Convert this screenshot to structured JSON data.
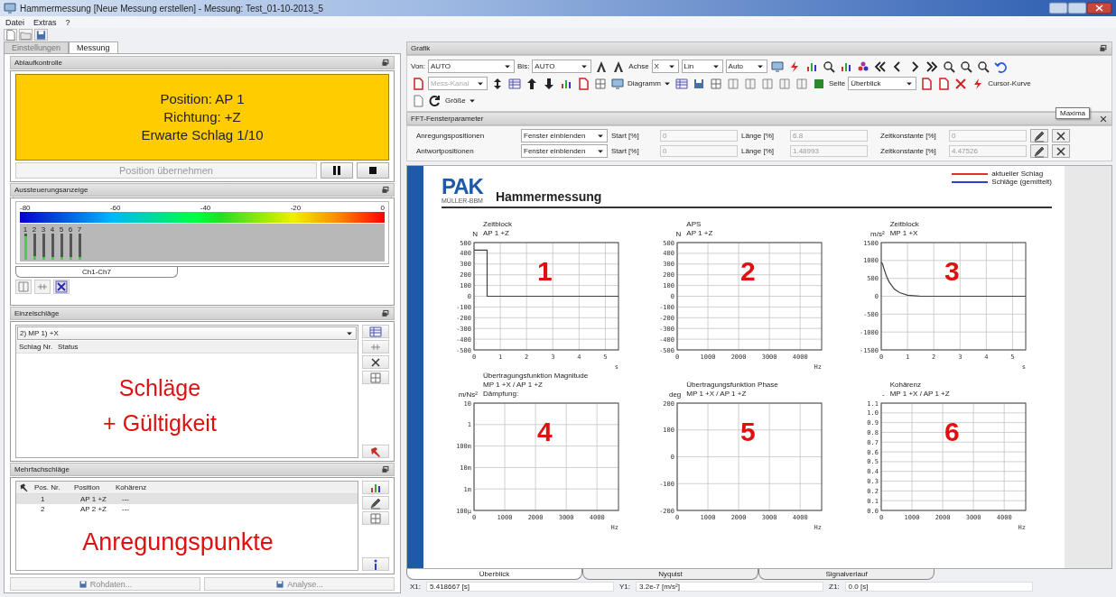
{
  "window": {
    "title": "Hammermessung [Neue Messung erstellen] - Messung: Test_01-10-2013_5"
  },
  "menu": [
    "Datei",
    "Extras",
    "?"
  ],
  "left_tabs": [
    {
      "label": "Einstellungen",
      "selected": false,
      "disabled": true
    },
    {
      "label": "Messung",
      "selected": true,
      "disabled": false
    }
  ],
  "ablauf": {
    "title": "Ablaufkontrolle",
    "lines": [
      "Position: AP 1",
      "Richtung: +Z",
      "Erwarte Schlag 1/10"
    ],
    "button": {
      "label": "Position übernehmen",
      "disabled": true
    }
  },
  "aussteuerung": {
    "title": "Aussteuerungsanzeige",
    "scale": [
      "-80",
      "-60",
      "-40",
      "-20",
      "0"
    ],
    "tab": {
      "label": "Ch1-Ch7",
      "selected": true
    },
    "channels": [
      {
        "label": "1",
        "level": 0.9
      },
      {
        "label": "2",
        "level": 0.15
      },
      {
        "label": "3",
        "level": 0.1
      },
      {
        "label": "4",
        "level": 0.1
      },
      {
        "label": "5",
        "level": 0.1
      },
      {
        "label": "6",
        "level": 0.1
      },
      {
        "label": "7",
        "level": 0.1
      }
    ]
  },
  "einzel": {
    "title": "Einzelschläge",
    "select": "2) MP 1) +X",
    "columns": [
      "Schlag Nr.",
      "Status"
    ],
    "overlay": [
      "Schläge",
      "+ Gültigkeit"
    ]
  },
  "mehrfach": {
    "title": "Mehrfachschläge",
    "columns": [
      "Pos. Nr.",
      "Position",
      "Kohärenz"
    ],
    "rows": [
      {
        "cells": [
          "1",
          "AP 1 +Z",
          "---"
        ],
        "selected": true
      },
      {
        "cells": [
          "2",
          "AP 2 +Z",
          "---"
        ],
        "selected": false
      }
    ],
    "overlay": "Anregungspunkte"
  },
  "bottom_buttons": [
    {
      "label": "Rohdaten...",
      "disabled": true
    },
    {
      "label": "Analyse...",
      "disabled": true
    }
  ],
  "grafik": {
    "title": "Grafik",
    "von_label": "Von:",
    "von": "AUTO",
    "bis_label": "Bis:",
    "bis": "AUTO",
    "achse_label": "Achse",
    "achse": "X",
    "scale": "Lin",
    "range": "Auto",
    "mess_kanal": "Mess-Kanal",
    "diagramm": "Diagramm",
    "seite_label": "Seite",
    "seite": "Überblick",
    "cursor": "Cursor-Kurve",
    "groesse": "Größe",
    "tooltip": "Maxima"
  },
  "fft": {
    "title": "FFT-Fensterparameter",
    "rows": [
      {
        "label": "Anregungspositionen",
        "window": "Fenster einblenden",
        "start_label": "Start [%]",
        "start": "0",
        "len_label": "Länge [%]",
        "len": "6.8",
        "tc_label": "Zeitkonstante [%]",
        "tc": "0"
      },
      {
        "label": "Antwortpositionen",
        "window": "Fenster einblenden",
        "start_label": "Start [%]",
        "start": "0",
        "len_label": "Länge [%]",
        "len": "1.48993",
        "tc_label": "Zeitkonstante [%]",
        "tc": "4.47526"
      }
    ]
  },
  "report": {
    "logo": "PAK",
    "logo_sub": "MÜLLER-BBM",
    "title": "Hammermessung",
    "legend": [
      {
        "label": "aktueller Schlag",
        "color": "#e03030"
      },
      {
        "label": "Schläge (gemittelt)",
        "color": "#3040d0"
      }
    ],
    "charts": [
      {
        "number": "1",
        "title": [
          "Zeitblock",
          "AP 1 +Z"
        ],
        "chart_data": {
          "type": "line",
          "ylabel": "N",
          "xlabel": "s",
          "xlim": [
            0,
            5.5
          ],
          "ylim": [
            -500,
            500
          ],
          "xticks": [
            0,
            1,
            2,
            3,
            4,
            5
          ],
          "yticks": [
            -500,
            -400,
            -300,
            -200,
            -100,
            0,
            100,
            200,
            300,
            400,
            500
          ],
          "x": [
            0,
            0.5,
            0.5,
            5.5
          ],
          "grid": true,
          "series": [
            {
              "color": "#404040",
              "values": [
                430,
                430,
                0,
                0
              ]
            }
          ]
        }
      },
      {
        "number": "2",
        "title": [
          "APS",
          "AP 1 +Z"
        ],
        "chart_data": {
          "type": "line",
          "ylabel": "N",
          "xlabel": "Hz",
          "xlim": [
            0,
            4700
          ],
          "ylim": [
            -500,
            500
          ],
          "xticks": [
            0,
            1000,
            2000,
            3000,
            4000
          ],
          "yticks": [
            -500,
            -400,
            -300,
            -200,
            -100,
            0,
            100,
            200,
            300,
            400,
            500
          ],
          "grid": true
        }
      },
      {
        "number": "3",
        "title": [
          "Zeitblock",
          "MP 1 +X"
        ],
        "chart_data": {
          "type": "line",
          "ylabel": "m/s²",
          "xlabel": "s",
          "xlim": [
            0,
            5.5
          ],
          "ylim": [
            -1500,
            1500
          ],
          "xticks": [
            0,
            1,
            2,
            3,
            4,
            5
          ],
          "yticks": [
            -1500,
            -1000,
            -500,
            0,
            500,
            1000,
            1500
          ],
          "x": [
            0,
            0.05,
            0.1,
            0.2,
            0.3,
            0.5,
            0.7,
            1.0,
            1.5,
            5.5
          ],
          "grid": true,
          "series": [
            {
              "color": "#404040",
              "values": [
                950,
                900,
                780,
                560,
                400,
                200,
                100,
                30,
                0,
                0
              ]
            }
          ]
        }
      },
      {
        "number": "4",
        "title": [
          "Übertragungsfunktion Magnitude",
          "MP 1 +X / AP 1 +Z",
          "Dämpfung:"
        ],
        "axes": {
          "ylabel": "m/Ns²",
          "xlabel": "Hz",
          "y_labels": [
            "10",
            "1",
            "100m",
            "10m",
            "1m",
            "100µ"
          ],
          "x_labels": [
            "0",
            "1000",
            "2000",
            "3000",
            "4000"
          ]
        }
      },
      {
        "number": "5",
        "title": [
          "Übertragungsfunktion Phase",
          "MP 1 +X / AP 1 +Z"
        ],
        "chart_data": {
          "type": "line",
          "ylabel": "deg",
          "xlabel": "Hz",
          "xlim": [
            0,
            4700
          ],
          "ylim": [
            -200,
            200
          ],
          "xticks": [
            0,
            1000,
            2000,
            3000,
            4000
          ],
          "yticks": [
            -200,
            -100,
            0,
            100,
            200
          ],
          "grid": true
        }
      },
      {
        "number": "6",
        "title": [
          "Kohärenz",
          "MP 1 +X / AP 1 +Z"
        ],
        "chart_data": {
          "type": "line",
          "ylabel": "-",
          "xlabel": "Hz",
          "xlim": [
            0,
            4700
          ],
          "ylim": [
            0,
            1.1
          ],
          "xticks": [
            0,
            1000,
            2000,
            3000,
            4000
          ],
          "yticks": [
            {
              "value": 0,
              "label": "0.0"
            },
            {
              "value": 0.1,
              "label": "0.1"
            },
            {
              "value": 0.2,
              "label": "0.2"
            },
            {
              "value": 0.3,
              "label": "0.3"
            },
            {
              "value": 0.4,
              "label": "0.4"
            },
            {
              "value": 0.5,
              "label": "0.5"
            },
            {
              "value": 0.6,
              "label": "0.6"
            },
            {
              "value": 0.7,
              "label": "0.7"
            },
            {
              "value": 0.8,
              "label": "0.8"
            },
            {
              "value": 0.9,
              "label": "0.9"
            },
            {
              "value": 1,
              "label": "1.0"
            },
            {
              "value": 1.1,
              "label": "1.1"
            }
          ],
          "grid": true
        }
      }
    ]
  },
  "view_tabs": [
    {
      "label": "Überblick",
      "selected": true
    },
    {
      "label": "Nyquist",
      "selected": false
    },
    {
      "label": "Signalverlauf",
      "selected": false
    }
  ],
  "status": [
    {
      "label": "X1:",
      "value": "5.418667 [s]"
    },
    {
      "label": "Y1:",
      "value": "3.2e-7 [m/s²]"
    },
    {
      "label": "Z1:",
      "value": "0.0 [s]"
    }
  ]
}
